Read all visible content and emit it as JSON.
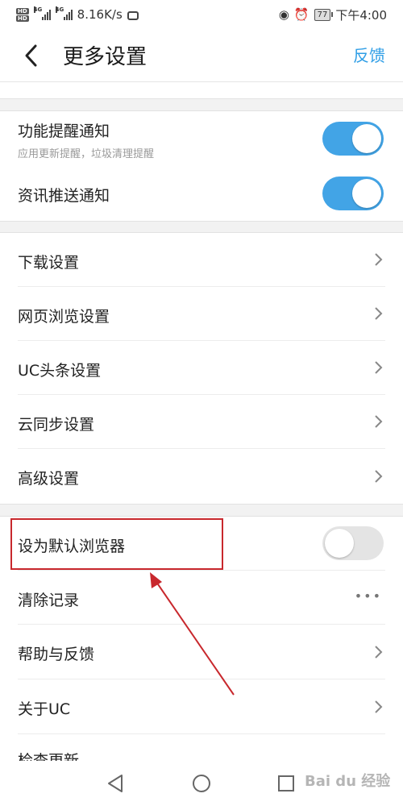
{
  "status_bar": {
    "hd_badges": [
      "HD",
      "HD"
    ],
    "network_tags": [
      "4G",
      "4G"
    ],
    "speed": "8.16K/s",
    "battery": "77",
    "time": "下午4:00"
  },
  "header": {
    "title": "更多设置",
    "action": "反馈"
  },
  "notifications": [
    {
      "label": "功能提醒通知",
      "sub": "应用更新提醒，垃圾清理提醒",
      "on": true
    },
    {
      "label": "资讯推送通知",
      "on": true
    }
  ],
  "settings": [
    {
      "label": "下载设置"
    },
    {
      "label": "网页浏览设置"
    },
    {
      "label": "UC头条设置"
    },
    {
      "label": "云同步设置"
    },
    {
      "label": "高级设置"
    }
  ],
  "misc": {
    "default_browser": {
      "label": "设为默认浏览器",
      "on": false
    },
    "clear_records": {
      "label": "清除记录",
      "more": "•••"
    },
    "help": {
      "label": "帮助与反馈"
    },
    "about": {
      "label": "关于UC"
    },
    "check_update": {
      "label": "检查更新"
    }
  },
  "watermark": "Bai du 经验",
  "colors": {
    "accent": "#42a4e6",
    "link": "#2f9ee6",
    "annotation": "#c8282d"
  }
}
